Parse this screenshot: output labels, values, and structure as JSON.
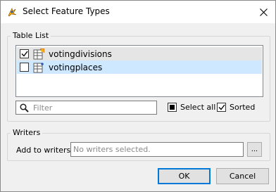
{
  "window": {
    "title": "Select Feature Types",
    "app_icon": "fme-icon",
    "close_icon": "close-icon"
  },
  "table_list": {
    "group_label": "Table List",
    "items": [
      {
        "label": "votingdivisions",
        "checked": true,
        "highlight": "hover"
      },
      {
        "label": "votingplaces",
        "checked": false,
        "highlight": "selected"
      }
    ],
    "filter_placeholder": "Filter",
    "select_all_label": "Select all",
    "select_all_state": "indeterminate",
    "sorted_label": "Sorted",
    "sorted_checked": true
  },
  "writers": {
    "group_label": "Writers",
    "add_label": "Add to writers:",
    "field_placeholder": "No writers selected.",
    "browse_label": "..."
  },
  "buttons": {
    "ok": "OK",
    "cancel": "Cancel"
  },
  "colors": {
    "selected_row": "#cde8ff",
    "hover_row": "#e5e5e5",
    "default_button_border": "#0078d7"
  }
}
